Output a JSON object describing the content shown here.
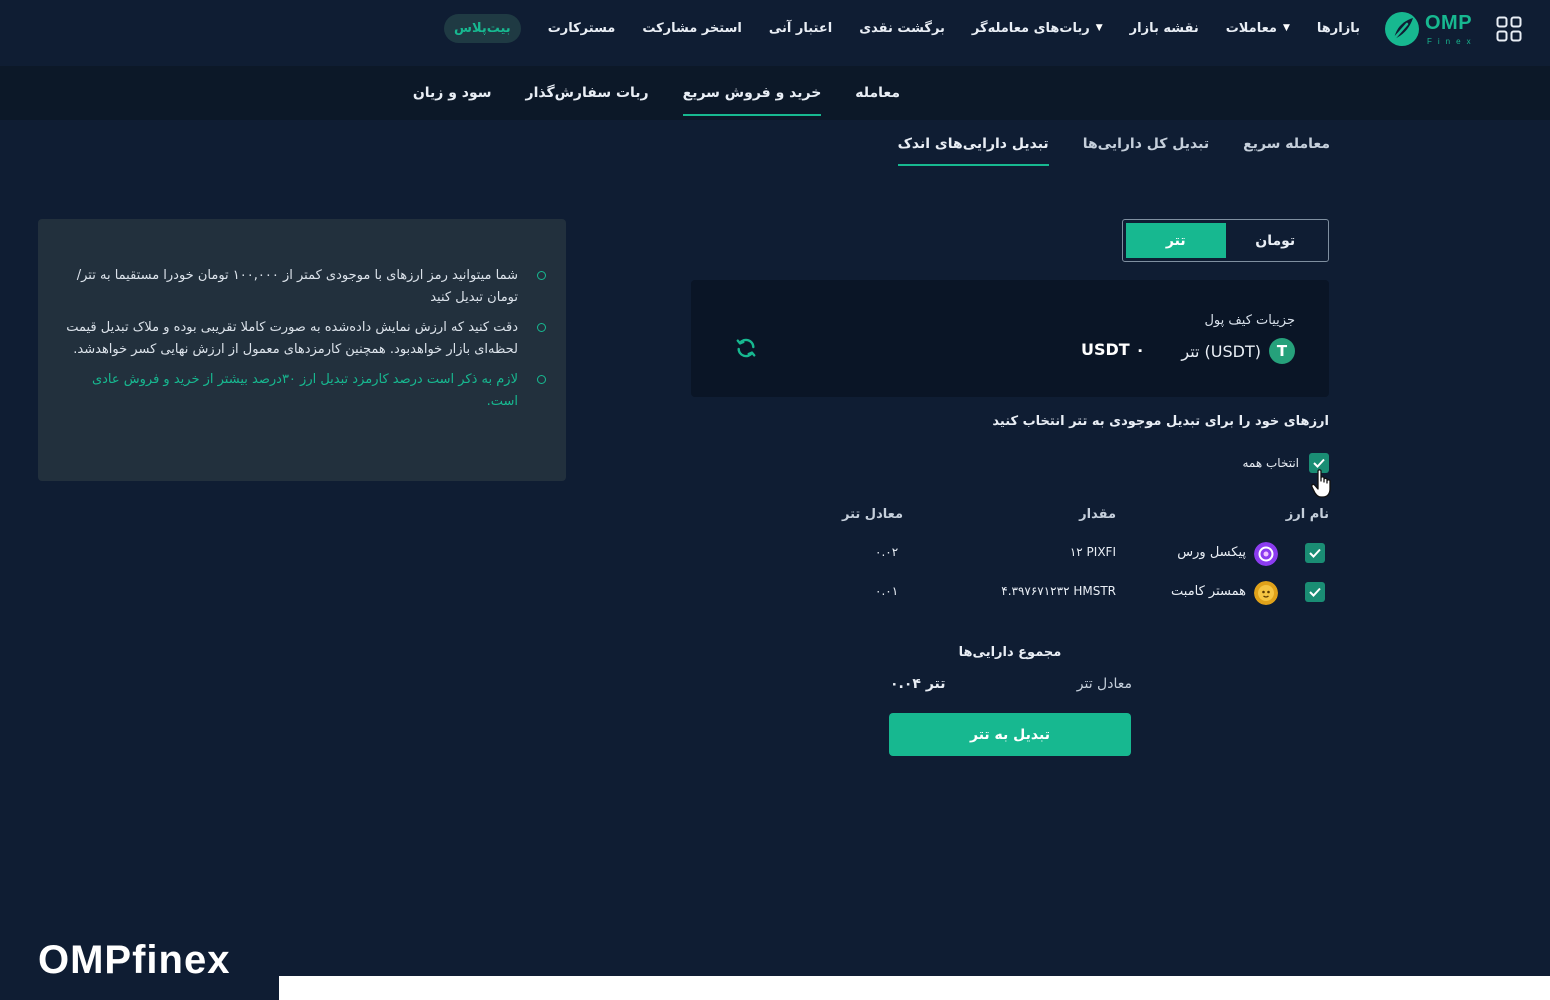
{
  "header": {
    "logo_text": "OMP",
    "logo_sub": "Finex",
    "nav_items": [
      {
        "label": "بازارها",
        "dropdown": false
      },
      {
        "label": "معاملات",
        "dropdown": true
      },
      {
        "label": "نقشه بازار",
        "dropdown": false
      },
      {
        "label": "ربات‌های معامله‌گر",
        "dropdown": true
      },
      {
        "label": "برگشت نقدی",
        "dropdown": false
      },
      {
        "label": "اعتبار آنی",
        "dropdown": false
      },
      {
        "label": "استخر مشارکت",
        "dropdown": false
      },
      {
        "label": "مسترکارت",
        "dropdown": false
      }
    ],
    "pill_label": "بیت‌پلاس"
  },
  "subnav": {
    "items": [
      "معامله",
      "خرید و فروش سریع",
      "ربات سفارش‌گذار",
      "سود و زیان"
    ],
    "active_index": 1
  },
  "tabs": {
    "items": [
      "معامله سریع",
      "تبدیل کل دارایی‌ها",
      "تبدیل دارایی‌های اندک"
    ],
    "active_index": 2
  },
  "toggle": {
    "options": [
      "تومان",
      "تتر"
    ],
    "active_index": 1
  },
  "wallet": {
    "title": "جزییات کیف پول",
    "coin_label": "تتر (USDT)",
    "coin_glyph": "T",
    "balance": "USDT ۰"
  },
  "instruction": "ارزهای خود را برای تبدیل موجودی به تتر انتخاب کنید",
  "select_all_label": "انتخاب همه",
  "table": {
    "headers": {
      "name": "نام ارز",
      "amount": "مقدار",
      "equiv": "معادل تتر"
    },
    "rows": [
      {
        "name": "پیکسل ورس",
        "amount": "۱۲ PIXFI",
        "equiv": "۰.۰۲",
        "icon_color": "#8b3cf0"
      },
      {
        "name": "همستر کامبت",
        "amount": "۴.۳۹۷۶۷۱۲۳۲ HMSTR",
        "equiv": "۰.۰۱",
        "icon_color": "#e0a21a"
      }
    ]
  },
  "totals": {
    "title": "مجموع دارایی‌ها",
    "label": "معادل تتر",
    "value": "۰.۰۴ تتر"
  },
  "convert_button": "تبدیل به تتر",
  "info_notes": [
    "شما میتوانید رمز ارزهای با موجودی کمتر از ۱۰۰,۰۰۰ تومان خودرا مستقیما به تتر/تومان تبدیل کنید",
    "دقت کنید که ارزش نمایش داده‌شده به صورت کاملا تقریبی بوده و ملاک تبدیل قیمت لحظه‌ای بازار خواهدبود. همچنین کارمزدهای معمول از ارزش نهایی کسر خواهدشد.",
    "لازم به ذکر است درصد کارمزد تبدیل ارز ۳۰درصد بیشتر از خرید و فروش عادی است."
  ],
  "brand_text": "OMPfinex",
  "colors": {
    "background": "#0f1d33",
    "accent": "#17b890",
    "card": "#0a1526",
    "panel": "#22303d"
  }
}
